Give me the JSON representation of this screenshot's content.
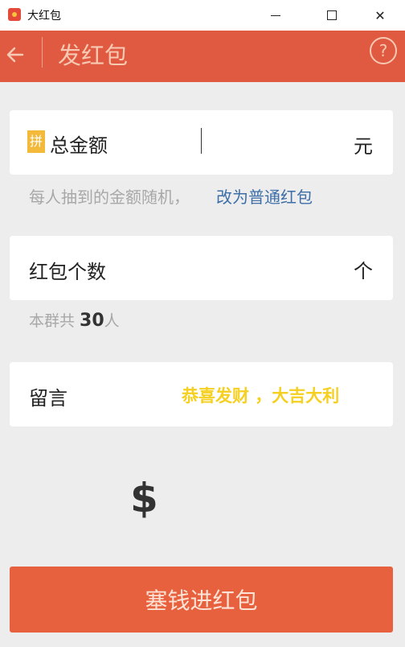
{
  "window": {
    "title": "大红包",
    "minimize": "",
    "maximize": "",
    "close": "✕"
  },
  "header": {
    "back_icon": "arrow-left-icon",
    "title": "发红包",
    "help": "?"
  },
  "amount": {
    "pin_badge": "拼",
    "label": "总金额",
    "unit": "元"
  },
  "hint": {
    "random_text": "每人抽到的金额随机，",
    "switch_link": "改为普通红包"
  },
  "count": {
    "label": "红包个数",
    "unit": "个"
  },
  "group": {
    "prefix": "本群共 ",
    "number": "30",
    "suffix": "人"
  },
  "message": {
    "label": "留言",
    "value": "恭喜发财 ，大吉大利"
  },
  "amount_display": {
    "symbol": "$"
  },
  "submit": {
    "label": "塞钱进红包"
  },
  "colors": {
    "header": "#e05a42",
    "submit": "#e7613f",
    "link": "#3d6ea8",
    "message_text": "#f5d020",
    "pin_badge": "#f3b93b"
  }
}
